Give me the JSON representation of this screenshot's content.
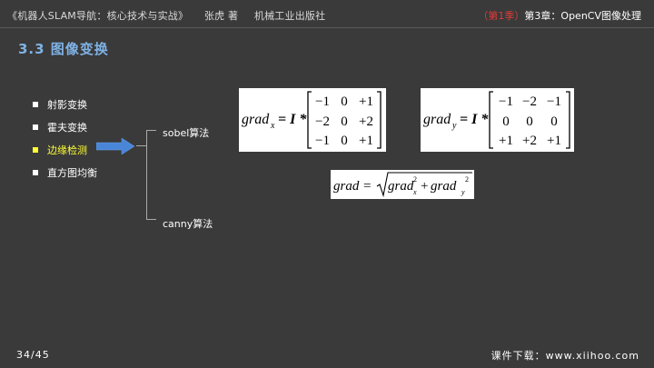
{
  "header": {
    "book_title": "《机器人SLAM导航：核心技术与实战》",
    "author": "张虎 著",
    "publisher": "机械工业出版社",
    "season": "（第1季）",
    "chapter": "第3章：OpenCV图像处理"
  },
  "section_title": "3.3  图像变换",
  "menu": {
    "items": [
      {
        "label": "射影变换"
      },
      {
        "label": "霍夫变换"
      },
      {
        "label": "边缘检测"
      },
      {
        "label": "直方图均衡"
      }
    ],
    "active_index": 2
  },
  "branches": {
    "sobel_label": "sobel算法",
    "canny_label": "canny算法"
  },
  "formulas": {
    "gx": {
      "lhs_main": "grad",
      "lhs_sub": "x",
      "rhs": "= I *",
      "matrix": [
        [
          "−1",
          "0",
          "+1"
        ],
        [
          "−2",
          "0",
          "+2"
        ],
        [
          "−1",
          "0",
          "+1"
        ]
      ]
    },
    "gy": {
      "lhs_main": "grad",
      "lhs_sub": "y",
      "rhs": "= I *",
      "matrix": [
        [
          "−1",
          "−2",
          "−1"
        ],
        [
          "0",
          "0",
          "0"
        ],
        [
          "+1",
          "+2",
          "+1"
        ]
      ]
    },
    "magnitude": {
      "lhs": "grad =",
      "term1": "grad",
      "sub1": "x",
      "sup1": "2",
      "plus": "+",
      "term2": "grad",
      "sub2": "y",
      "sup2": "2"
    }
  },
  "footer": {
    "page": "34/45",
    "download": "课件下载：www.xiihoo.com"
  },
  "colors": {
    "background": "#3a3a3a",
    "section_title": "#7fb2e5",
    "active_item": "#ffff33",
    "season": "#e03b3b",
    "arrow": "#4a86d8"
  }
}
